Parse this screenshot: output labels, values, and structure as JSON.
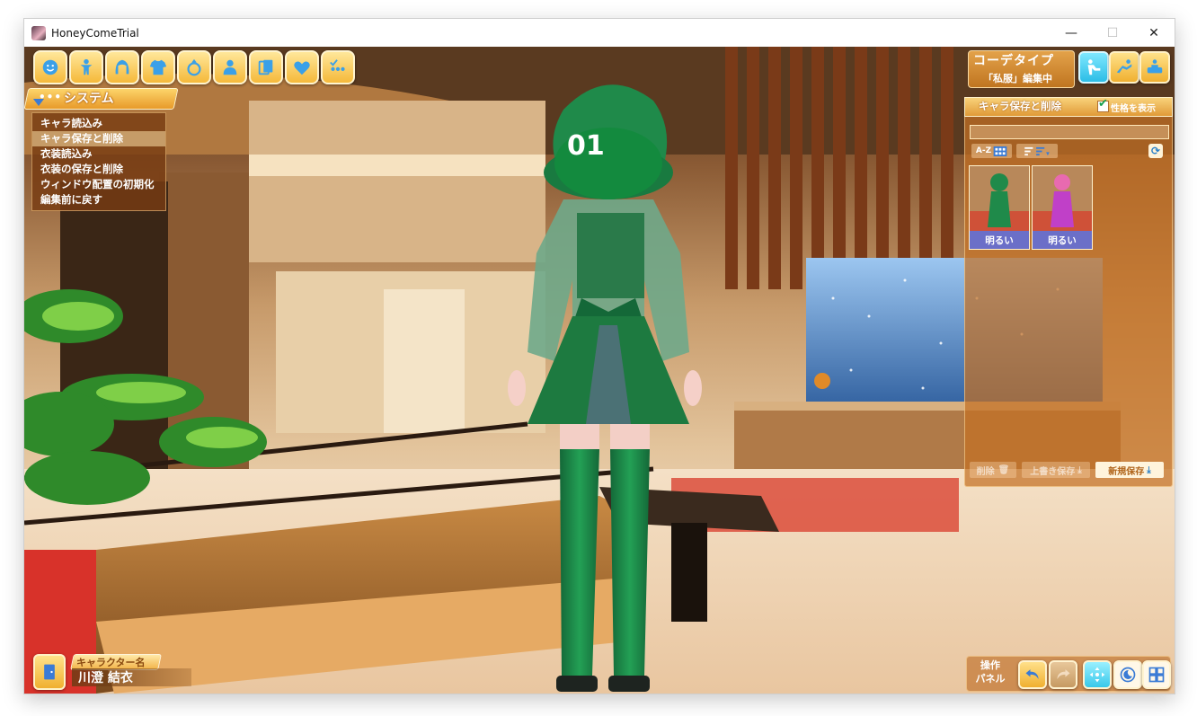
{
  "window": {
    "title": "HoneyComeTrial",
    "controls": {
      "minimize": "—",
      "maximize": "☐",
      "close": "✕"
    }
  },
  "top_toolbar": {
    "buttons": [
      {
        "name": "face-icon"
      },
      {
        "name": "body-icon"
      },
      {
        "name": "hair-icon"
      },
      {
        "name": "clothes-icon"
      },
      {
        "name": "accessory-ring-icon"
      },
      {
        "name": "personality-icon"
      },
      {
        "name": "cards-icon"
      },
      {
        "name": "heart-icon"
      },
      {
        "name": "system-icon"
      }
    ]
  },
  "system_menu": {
    "title": "システム",
    "items": [
      {
        "label": "キャラ読込み",
        "active": false
      },
      {
        "label": "キャラ保存と削除",
        "active": true
      },
      {
        "label": "衣装読込み",
        "active": false
      },
      {
        "label": "衣装の保存と削除",
        "active": false
      },
      {
        "label": "ウィンドウ配置の初期化",
        "active": false
      },
      {
        "label": "編集前に戻す",
        "active": false
      }
    ]
  },
  "coordinate": {
    "title": "コーデタイプ",
    "subtitle": "「私服」編集中"
  },
  "save_panel": {
    "title": "キャラ保存と削除",
    "show_personality_label": "性格を表示",
    "search": {
      "value": "",
      "placeholder": ""
    },
    "sort_az": "A-Z",
    "cards": [
      {
        "label": "明るい"
      },
      {
        "label": "明るい"
      }
    ],
    "delete_label": "削除",
    "overwrite_label": "上書き保存",
    "new_save_label": "新規保存"
  },
  "character": {
    "name_tag": "キャラクター名",
    "name": "川澄 結衣",
    "jersey_number": "01"
  },
  "ops_panel": {
    "label_line1": "操作",
    "label_line2": "パネル"
  },
  "colors": {
    "accent_gold": "#f5b93a",
    "active_cyan": "#2cbde6",
    "outfit_green": "#1f8a4a",
    "card_label": "#6b6fc8"
  }
}
